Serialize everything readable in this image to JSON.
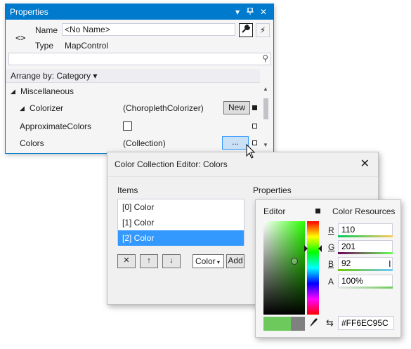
{
  "properties": {
    "title": "Properties",
    "name_label": "Name",
    "name_value": "<No Name>",
    "type_label": "Type",
    "type_value": "MapControl",
    "arrange_by": "Arrange by: Category",
    "category": "Miscellaneous",
    "rows": [
      {
        "name": "Colorizer",
        "value": "(ChoroplethColorizer)",
        "button": "New"
      },
      {
        "name": "ApproximateColors",
        "value": ""
      },
      {
        "name": "Colors",
        "value": "(Collection)",
        "button": "..."
      }
    ]
  },
  "dialog": {
    "title": "Color Collection Editor: Colors",
    "items_label": "Items",
    "properties_label": "Properties",
    "items": [
      "[0] Color",
      "[1] Color",
      "[2] Color"
    ],
    "selected_index": 2,
    "color_dropdown": "Color",
    "add_label": "Add"
  },
  "picker": {
    "editor_tab": "Editor",
    "resources_tab": "Color Resources",
    "r_label": "R",
    "r_value": "110",
    "g_label": "G",
    "g_value": "201",
    "b_label": "B",
    "b_value": "92",
    "a_label": "A",
    "a_value": "100%",
    "hex_value": "#FF6EC95C",
    "new_color": "#6EC95C",
    "old_color": "#808080"
  },
  "colors": {
    "accent": "#007acc",
    "selection": "#3399ff"
  }
}
